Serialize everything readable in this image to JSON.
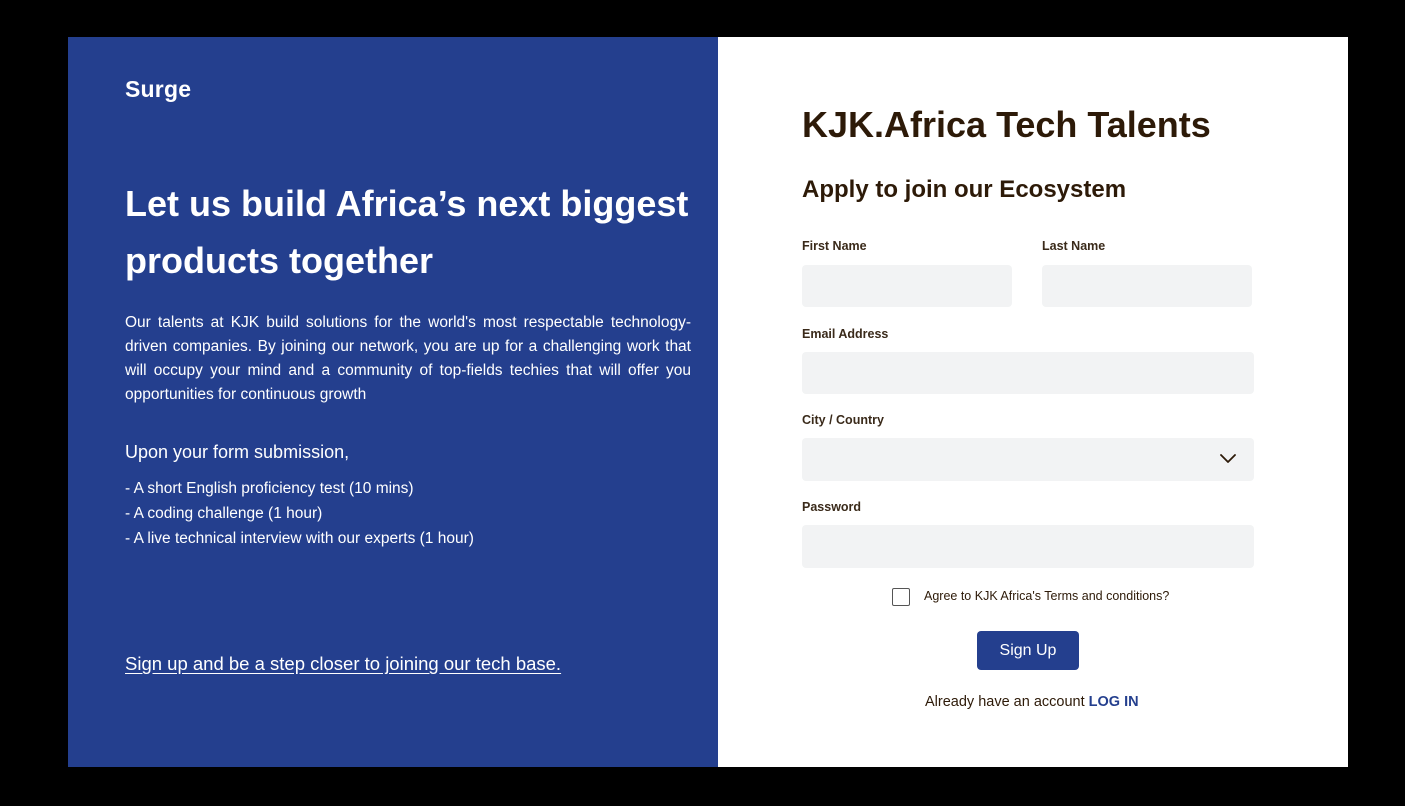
{
  "brand": "Surge",
  "hero": {
    "title": "Let us build Africa’s next biggest products together",
    "body": "Our talents at KJK build solutions for the world's most respectable technology-driven companies. By joining our network, you are up for a challenging work that will occupy your mind and a community of top-fields techies that will offer you opportunities for continuous growth",
    "steps_heading": "Upon your form submission,",
    "steps": [
      "- A short English proficiency test (10 mins)",
      "- A coding challenge (1 hour)",
      "- A live technical interview with our experts (1 hour)"
    ],
    "cta_link": "Sign up and be a step closer to joining our tech base."
  },
  "form": {
    "title": "KJK.Africa Tech Talents",
    "subtitle": "Apply to join our Ecosystem",
    "first_name_label": "First Name",
    "first_name_value": "",
    "last_name_label": "Last Name",
    "last_name_value": "",
    "email_label": "Email Address",
    "email_value": "",
    "city_label": "City / Country",
    "city_value": "",
    "password_label": "Password",
    "password_value": "",
    "terms_label": "Agree to KJK Africa's Terms and conditions?",
    "terms_checked": false,
    "submit_label": "Sign Up",
    "login_prompt": "Already have an account",
    "login_link": "LOG IN"
  },
  "icons": {
    "select_chevron": "chevron-down-icon"
  },
  "colors": {
    "brand_blue": "#243f8e",
    "heading_brown": "#2d1a08",
    "field_bg": "#f2f3f4"
  }
}
